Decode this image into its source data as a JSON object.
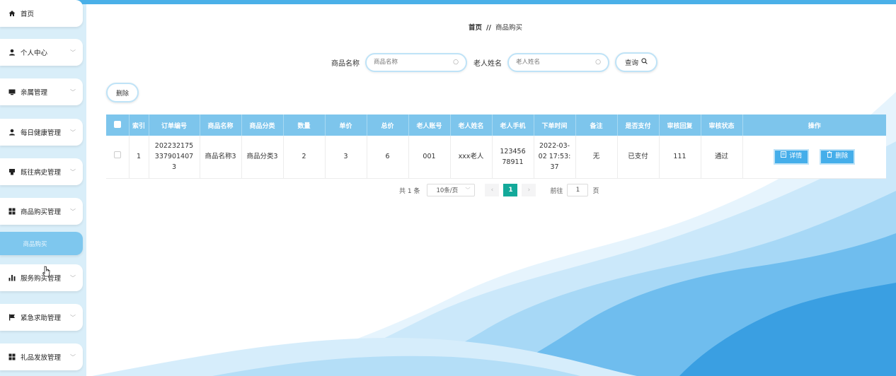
{
  "sidebar": {
    "items": [
      {
        "label": "首页",
        "icon": "home-icon",
        "has_chevron": false
      },
      {
        "label": "个人中心",
        "icon": "user-icon",
        "has_chevron": true
      },
      {
        "label": "亲属管理",
        "icon": "monitor-icon",
        "has_chevron": true
      },
      {
        "label": "每日健康管理",
        "icon": "user-icon",
        "has_chevron": true
      },
      {
        "label": "既往病史管理",
        "icon": "clipboard-icon",
        "has_chevron": true
      },
      {
        "label": "商品购买管理",
        "icon": "grid-icon",
        "has_chevron": true
      },
      {
        "label": "商品购买",
        "icon": "",
        "has_chevron": false
      },
      {
        "label": "服务购买管理",
        "icon": "bar-chart-icon",
        "has_chevron": true
      },
      {
        "label": "紧急求助管理",
        "icon": "flag-icon",
        "has_chevron": true
      },
      {
        "label": "礼品发放管理",
        "icon": "grid-icon",
        "has_chevron": true
      }
    ]
  },
  "breadcrumb": {
    "home": "首页",
    "sep": "//",
    "current": "商品购买"
  },
  "search": {
    "product_label": "商品名称",
    "product_placeholder": "商品名称",
    "elder_label": "老人姓名",
    "elder_placeholder": "老人姓名",
    "query_label": "查询"
  },
  "toolbar": {
    "delete_label": "删除"
  },
  "table": {
    "headers": [
      "索引",
      "订单编号",
      "商品名称",
      "商品分类",
      "数量",
      "单价",
      "总价",
      "老人账号",
      "老人姓名",
      "老人手机",
      "下单时间",
      "备注",
      "是否支付",
      "审核回复",
      "审核状态",
      "操作"
    ],
    "rows": [
      {
        "index": "1",
        "order_no": "2022321753379014073",
        "product_name": "商品名称3",
        "category": "商品分类3",
        "quantity": "2",
        "unit_price": "3",
        "total": "6",
        "elder_account": "001",
        "elder_name": "xxx老人",
        "elder_phone": "12345678911",
        "order_time": "2022-03-02 17:53:37",
        "remark": "无",
        "paid": "已支付",
        "reply": "111",
        "status": "通过",
        "detail_label": "详情",
        "delete_label": "删除"
      }
    ]
  },
  "pagination": {
    "total_text": "共 1 条",
    "page_size": "10条/页",
    "current_page": "1",
    "goto_label": "前往",
    "goto_value": "1",
    "page_unit": "页"
  },
  "colors": {
    "accent": "#45aeea",
    "header": "#7dc5ec",
    "sidebar": "#d9eef9",
    "pager_active": "#13a99a"
  }
}
